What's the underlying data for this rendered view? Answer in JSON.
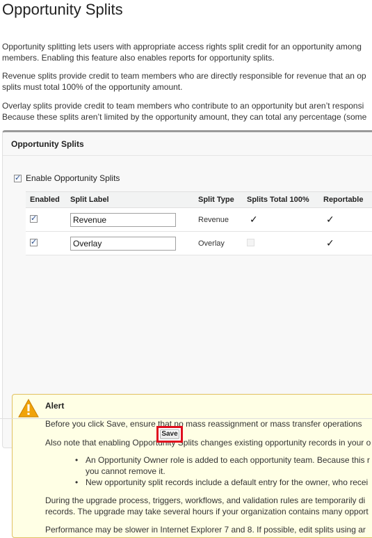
{
  "page": {
    "title": "Opportunity Splits"
  },
  "intro": {
    "p1": [
      "Opportunity splitting lets users with appropriate access rights split credit for an opportunity among",
      "members. Enabling this feature also enables reports for opportunity splits."
    ],
    "p2": [
      "Revenue splits provide credit to team members who are directly responsible for revenue that an op",
      "splits must total 100% of the opportunity amount."
    ],
    "p3": [
      "Overlay splits provide credit to team members who contribute to an opportunity but aren’t responsi",
      "Because these splits aren’t limited by the opportunity amount, they can total any percentage (some"
    ]
  },
  "panel": {
    "header": "Opportunity Splits",
    "enable_label": "Enable Opportunity Splits",
    "enable_checked": true,
    "columns": [
      "Enabled",
      "Split Label",
      "Split Type",
      "Splits Total 100%",
      "Reportable"
    ],
    "rows": [
      {
        "enabled": true,
        "label": "Revenue",
        "type": "Revenue",
        "total100": true,
        "reportable": true
      },
      {
        "enabled": true,
        "label": "Overlay",
        "type": "Overlay",
        "total100": false,
        "reportable": true
      }
    ],
    "tick_glyph": "✓"
  },
  "alert": {
    "title": "Alert",
    "icon": "warning-icon",
    "p1": "Before you click Save, ensure that no mass reassignment or mass transfer operations",
    "p2": "Also note that enabling Opportunity Splits changes existing opportunity records in your o",
    "bullets": [
      [
        "An Opportunity Owner role is added to each opportunity team. Because this r",
        "you cannot remove it."
      ],
      [
        "New opportunity split records include a default entry for the owner, who recei"
      ]
    ],
    "p3": [
      "During the upgrade process, triggers, workflows, and validation rules are temporarily di",
      "records. The upgrade may take several hours if your organization contains many opport"
    ],
    "p4": "Performance may be slower in Internet Explorer 7 and 8. If possible, edit splits using ar"
  },
  "footer": {
    "save_label": "Save"
  },
  "colors": {
    "highlight": "#e0101e",
    "alert_bg": "#ffffe5",
    "alert_border": "#e0c060",
    "warning": "#f0a30a"
  }
}
